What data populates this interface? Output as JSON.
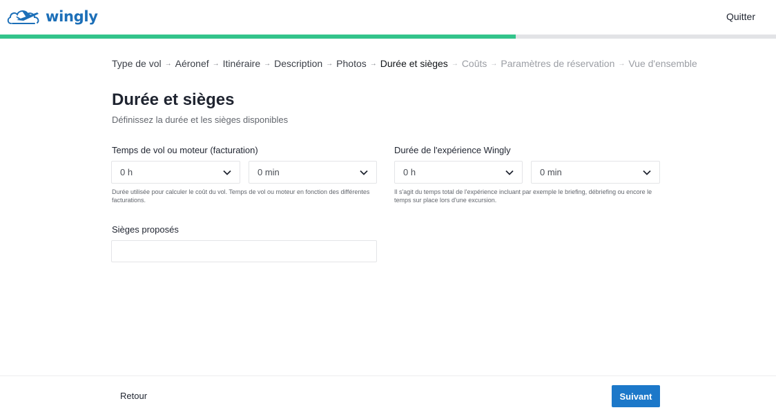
{
  "brand": {
    "name": "wingly",
    "color": "#1c6fb8",
    "logo_icon": "plane-cloud-icon"
  },
  "header": {
    "quit_label": "Quitter"
  },
  "progress": {
    "fraction": 0.665,
    "fill_color": "#33c48b",
    "track_color": "#e2e3e6"
  },
  "breadcrumb": {
    "steps": [
      {
        "label": "Type de vol",
        "state": "done"
      },
      {
        "label": "Aéronef",
        "state": "done"
      },
      {
        "label": "Itinéraire",
        "state": "done"
      },
      {
        "label": "Description",
        "state": "done"
      },
      {
        "label": "Photos",
        "state": "done"
      },
      {
        "label": "Durée et sièges",
        "state": "current"
      },
      {
        "label": "Coûts",
        "state": "future"
      },
      {
        "label": "Paramètres de réservation",
        "state": "future"
      },
      {
        "label": "Vue d'ensemble",
        "state": "future"
      }
    ]
  },
  "page": {
    "title": "Durée et sièges",
    "subtitle": "Définissez la durée et les sièges disponibles"
  },
  "flight_time": {
    "label": "Temps de vol ou moteur (facturation)",
    "hours_value": "0 h",
    "minutes_value": "0 min",
    "help": "Durée utilisée pour calculer le coût du vol. Temps de vol ou moteur en fonction des différentes facturations."
  },
  "experience_time": {
    "label": "Durée de l'expérience Wingly",
    "hours_value": "0 h",
    "minutes_value": "0 min",
    "help": "Il s'agit du temps total de l'expérience incluant par exemple le briefing, débriefing ou encore le temps sur place lors d'une excursion."
  },
  "seats": {
    "label": "Sièges proposés",
    "value": ""
  },
  "footer": {
    "back_label": "Retour",
    "next_label": "Suivant",
    "next_color": "#1c78c9"
  }
}
